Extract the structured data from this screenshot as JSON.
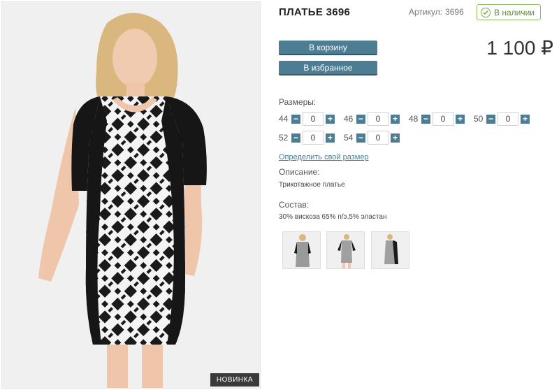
{
  "product": {
    "title": "ПЛАТЬЕ 3696",
    "sku_label": "Артикул:",
    "sku_value": "3696",
    "stock": "В наличии",
    "price": "1 100 ₽",
    "badge": "НОВИНКА"
  },
  "actions": {
    "cart": "В корзину",
    "favorites": "В избранное"
  },
  "sizes": {
    "label": "Размеры:",
    "items": [
      {
        "size": "44",
        "qty": "0"
      },
      {
        "size": "46",
        "qty": "0"
      },
      {
        "size": "48",
        "qty": "0"
      },
      {
        "size": "50",
        "qty": "0"
      },
      {
        "size": "52",
        "qty": "0"
      },
      {
        "size": "54",
        "qty": "0"
      }
    ],
    "minus": "−",
    "plus": "+",
    "size_link": "Определить свой размер"
  },
  "description": {
    "label": "Описание:",
    "text": "Трикотажное платье"
  },
  "composition": {
    "label": "Состав:",
    "text": "30% вискоза 65% п/э,5% эластан"
  },
  "colors": {
    "button": "#4d7d93",
    "stock_border": "#8cbf5e",
    "badge_bg": "#3b3b3b"
  }
}
